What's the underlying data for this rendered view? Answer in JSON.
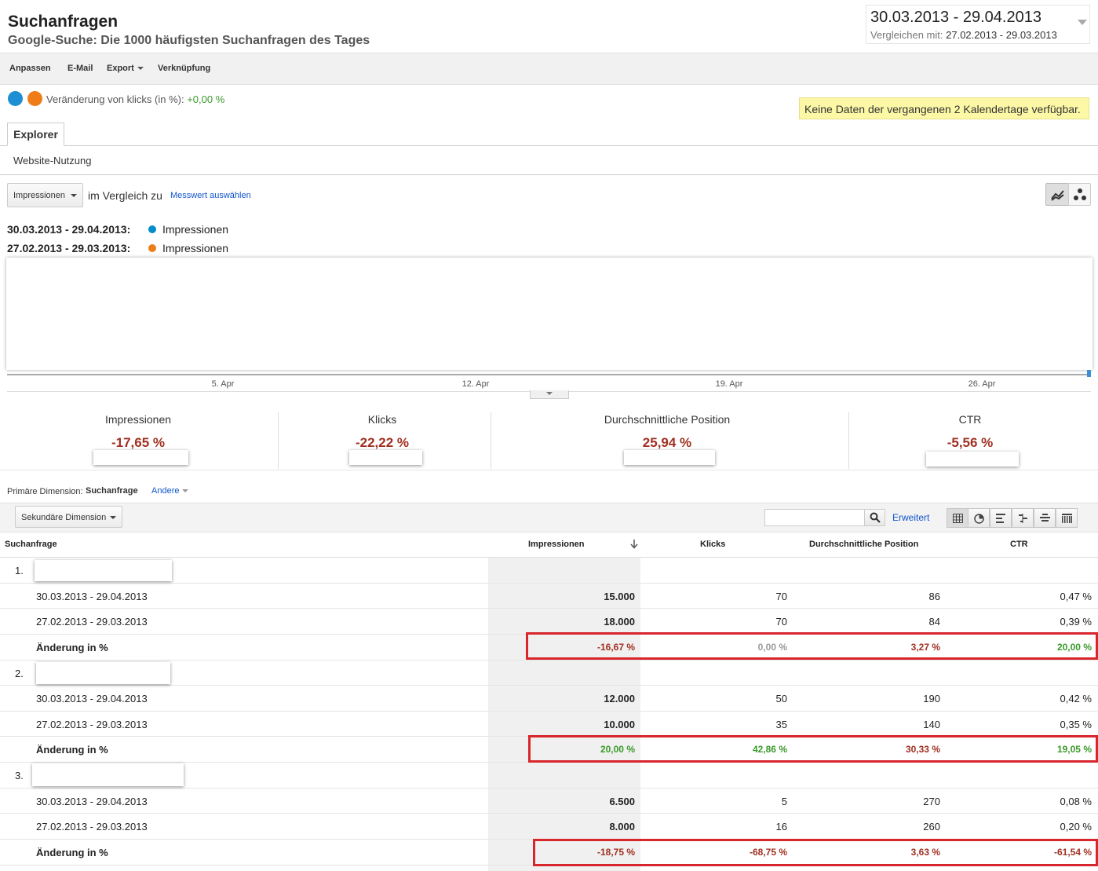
{
  "header": {
    "title": "Suchanfragen",
    "subtitle": "Google-Suche: Die 1000 häufigsten Suchanfragen des Tages",
    "date_range": "30.03.2013 - 29.04.2013",
    "compare_label": "Vergleichen mit:",
    "compare_range": "27.02.2013 - 29.03.2013"
  },
  "toolbar": {
    "customize": "Anpassen",
    "email": "E-Mail",
    "export": "Export",
    "shortcut": "Verknüpfung"
  },
  "segment": {
    "change_label": "Veränderung von klicks (in %):",
    "change_value": "+0,00 %",
    "colors": {
      "current": "#058dc7",
      "previous": "#ed7e17"
    }
  },
  "notice": "Keine Daten der vergangenen 2 Kalendertage verfügbar.",
  "tabs": {
    "explorer": "Explorer",
    "subtab": "Website-Nutzung"
  },
  "metric": {
    "selected": "Impressionen",
    "compare_label": "im Vergleich zu",
    "select_link": "Messwert auswählen"
  },
  "legend": [
    {
      "range": "30.03.2013 - 29.04.2013:",
      "name": "Impressionen",
      "color": "#058dc7"
    },
    {
      "range": "27.02.2013 - 29.03.2013:",
      "name": "Impressionen",
      "color": "#ed7e17"
    }
  ],
  "chart_data": {
    "type": "line",
    "x_ticks": [
      "5. Apr",
      "12. Apr",
      "19. Apr",
      "26. Apr"
    ],
    "series": [],
    "grid": false
  },
  "scorecards": [
    {
      "label": "Impressionen",
      "value": "-17,65 %"
    },
    {
      "label": "Klicks",
      "value": "-22,22 %"
    },
    {
      "label": "Durchschnittliche Position",
      "value": "25,94 %"
    },
    {
      "label": "CTR",
      "value": "-5,56 %"
    }
  ],
  "dimensions": {
    "primary_label": "Primäre Dimension:",
    "primary_value": "Suchanfrage",
    "other": "Andere",
    "secondary": "Sekundäre Dimension",
    "advanced": "Erweitert"
  },
  "table": {
    "columns": [
      "Suchanfrage",
      "Impressionen",
      "Klicks",
      "Durchschnittliche Position",
      "CTR"
    ],
    "groups": [
      {
        "index": "1.",
        "rows": [
          {
            "label": "30.03.2013 - 29.04.2013",
            "impressions": "15.000",
            "clicks": "70",
            "position": "86",
            "ctr": "0,47 %"
          },
          {
            "label": "27.02.2013 - 29.03.2013",
            "impressions": "18.000",
            "clicks": "70",
            "position": "84",
            "ctr": "0,39 %"
          }
        ],
        "change": {
          "label": "Änderung in %",
          "impressions": "-16,67 %",
          "clicks": "0,00 %",
          "position": "3,27 %",
          "ctr": "20,00 %"
        }
      },
      {
        "index": "2.",
        "rows": [
          {
            "label": "30.03.2013 - 29.04.2013",
            "impressions": "12.000",
            "clicks": "50",
            "position": "190",
            "ctr": "0,42 %"
          },
          {
            "label": "27.02.2013 - 29.03.2013",
            "impressions": "10.000",
            "clicks": "35",
            "position": "140",
            "ctr": "0,35 %"
          }
        ],
        "change": {
          "label": "Änderung in %",
          "impressions": "20,00 %",
          "clicks": "42,86 %",
          "position": "30,33 %",
          "ctr": "19,05 %"
        }
      },
      {
        "index": "3.",
        "rows": [
          {
            "label": "30.03.2013 - 29.04.2013",
            "impressions": "6.500",
            "clicks": "5",
            "position": "270",
            "ctr": "0,08 %"
          },
          {
            "label": "27.02.2013 - 29.03.2013",
            "impressions": "8.000",
            "clicks": "16",
            "position": "260",
            "ctr": "0,20 %"
          }
        ],
        "change": {
          "label": "Änderung in %",
          "impressions": "-18,75 %",
          "clicks": "-68,75 %",
          "position": "3,63 %",
          "ctr": "-61,54 %"
        }
      }
    ]
  }
}
